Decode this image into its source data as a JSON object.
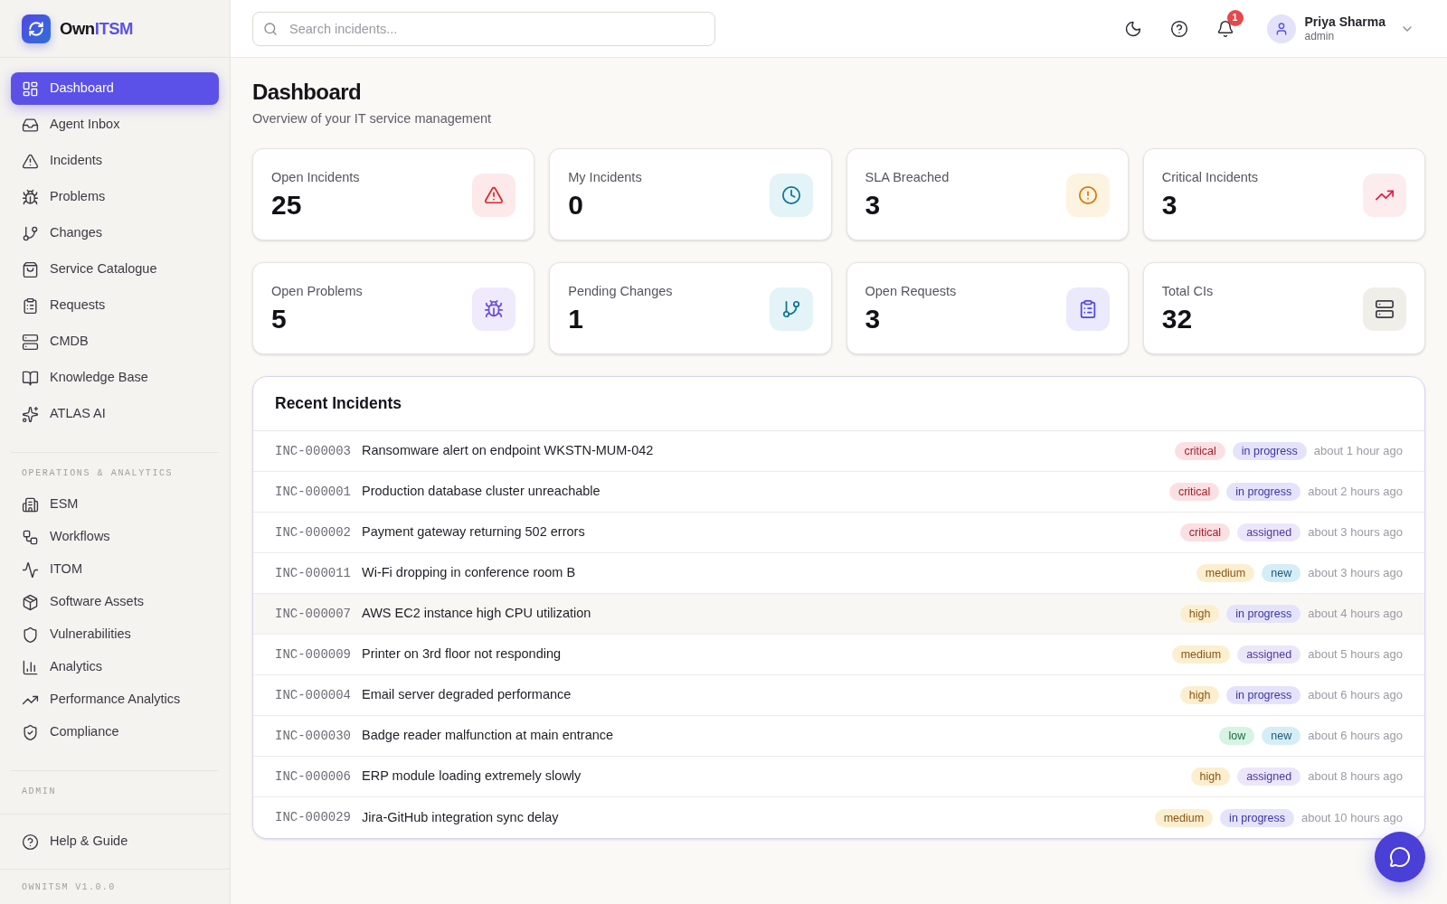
{
  "sidebar": {
    "brand": {
      "name_start": "Own",
      "name_accent": "ITSM"
    },
    "nav": [
      {
        "label": "Dashboard",
        "selected": true
      },
      {
        "label": "Agent Inbox",
        "selected": false
      },
      {
        "label": "Incidents",
        "selected": false
      },
      {
        "label": "Problems",
        "selected": false
      },
      {
        "label": "Changes",
        "selected": false
      },
      {
        "label": "Service Catalogue",
        "selected": false
      },
      {
        "label": "Requests",
        "selected": false
      },
      {
        "label": "CMDB",
        "selected": false
      },
      {
        "label": "Knowledge Base",
        "selected": false
      },
      {
        "label": "ATLAS AI",
        "selected": false
      }
    ],
    "sections": [
      {
        "heading": "OPERATIONS & ANALYTICS",
        "items": [
          {
            "label": "ESM",
            "selected": false
          },
          {
            "label": "Workflows",
            "selected": false
          },
          {
            "label": "ITOM",
            "selected": false
          },
          {
            "label": "Software Assets",
            "selected": false
          },
          {
            "label": "Vulnerabilities",
            "selected": false
          },
          {
            "label": "Analytics",
            "selected": false
          },
          {
            "label": "Performance Analytics",
            "selected": false
          },
          {
            "label": "Compliance",
            "selected": false
          }
        ]
      },
      {
        "heading": "ADMIN"
      }
    ],
    "footer_items": [
      {
        "label": "Help & Guide",
        "selected": false
      }
    ],
    "version": "OWNITSM V1.0.0"
  },
  "header": {
    "search": {
      "placeholder": "Search incidents..."
    },
    "notifications": {
      "count": "1"
    },
    "user": {
      "name": "Priya Sharma",
      "role": "admin"
    }
  },
  "page": {
    "title": "Dashboard",
    "subtitle": "Overview of your IT service management"
  },
  "stats": [
    {
      "label": "Open Incidents",
      "value": "25",
      "color": "#fde8ea"
    },
    {
      "label": "My Incidents",
      "value": "0",
      "color": "#e3f3f8"
    },
    {
      "label": "SLA Breached",
      "value": "3",
      "color": "#fdf3e1"
    },
    {
      "label": "Critical Incidents",
      "value": "3",
      "color": "#fdecee"
    },
    {
      "label": "Open Problems",
      "value": "5",
      "color": "#efeafc"
    },
    {
      "label": "Pending Changes",
      "value": "1",
      "color": "#e3f3f8"
    },
    {
      "label": "Open Requests",
      "value": "3",
      "color": "#ebe9fc"
    },
    {
      "label": "Total CIs",
      "value": "32",
      "color": "#efeee9"
    }
  ],
  "recent_incidents": {
    "title": "Recent Incidents",
    "rows": [
      {
        "id": "INC-000003",
        "title": "Ransomware alert on endpoint WKSTN-MUM-042",
        "priority": {
          "label": "critical",
          "color": "#fbe0e3"
        },
        "status": {
          "label": "in progress",
          "color": "#e4e3fb"
        },
        "time": "about 1 hour ago",
        "highlighted": false
      },
      {
        "id": "INC-000001",
        "title": "Production database cluster unreachable",
        "priority": {
          "label": "critical",
          "color": "#fbe0e3"
        },
        "status": {
          "label": "in progress",
          "color": "#e4e3fb"
        },
        "time": "about 2 hours ago",
        "highlighted": false
      },
      {
        "id": "INC-000002",
        "title": "Payment gateway returning 502 errors",
        "priority": {
          "label": "critical",
          "color": "#fbe0e3"
        },
        "status": {
          "label": "assigned",
          "color": "#ece6fa"
        },
        "time": "about 3 hours ago",
        "highlighted": false
      },
      {
        "id": "INC-000011",
        "title": "Wi-Fi dropping in conference room B",
        "priority": {
          "label": "medium",
          "color": "#fcefd0"
        },
        "status": {
          "label": "new",
          "color": "#d5edf6"
        },
        "time": "about 3 hours ago",
        "highlighted": false
      },
      {
        "id": "INC-000007",
        "title": "AWS EC2 instance high CPU utilization",
        "priority": {
          "label": "high",
          "color": "#fcefd0"
        },
        "status": {
          "label": "in progress",
          "color": "#e4e3fb"
        },
        "time": "about 4 hours ago",
        "highlighted": true
      },
      {
        "id": "INC-000009",
        "title": "Printer on 3rd floor not responding",
        "priority": {
          "label": "medium",
          "color": "#fcefd0"
        },
        "status": {
          "label": "assigned",
          "color": "#ece6fa"
        },
        "time": "about 5 hours ago",
        "highlighted": false
      },
      {
        "id": "INC-000004",
        "title": "Email server degraded performance",
        "priority": {
          "label": "high",
          "color": "#fcefd0"
        },
        "status": {
          "label": "in progress",
          "color": "#e4e3fb"
        },
        "time": "about 6 hours ago",
        "highlighted": false
      },
      {
        "id": "INC-000030",
        "title": "Badge reader malfunction at main entrance",
        "priority": {
          "label": "low",
          "color": "#d6f3e3"
        },
        "status": {
          "label": "new",
          "color": "#d5edf6"
        },
        "time": "about 6 hours ago",
        "highlighted": false
      },
      {
        "id": "INC-000006",
        "title": "ERP module loading extremely slowly",
        "priority": {
          "label": "high",
          "color": "#fcefd0"
        },
        "status": {
          "label": "assigned",
          "color": "#ece6fa"
        },
        "time": "about 8 hours ago",
        "highlighted": false
      },
      {
        "id": "INC-000029",
        "title": "Jira-GitHub integration sync delay",
        "priority": {
          "label": "medium",
          "color": "#fcefd0"
        },
        "status": {
          "label": "in progress",
          "color": "#e4e3fb"
        },
        "time": "about 10 hours ago",
        "highlighted": false
      }
    ]
  }
}
